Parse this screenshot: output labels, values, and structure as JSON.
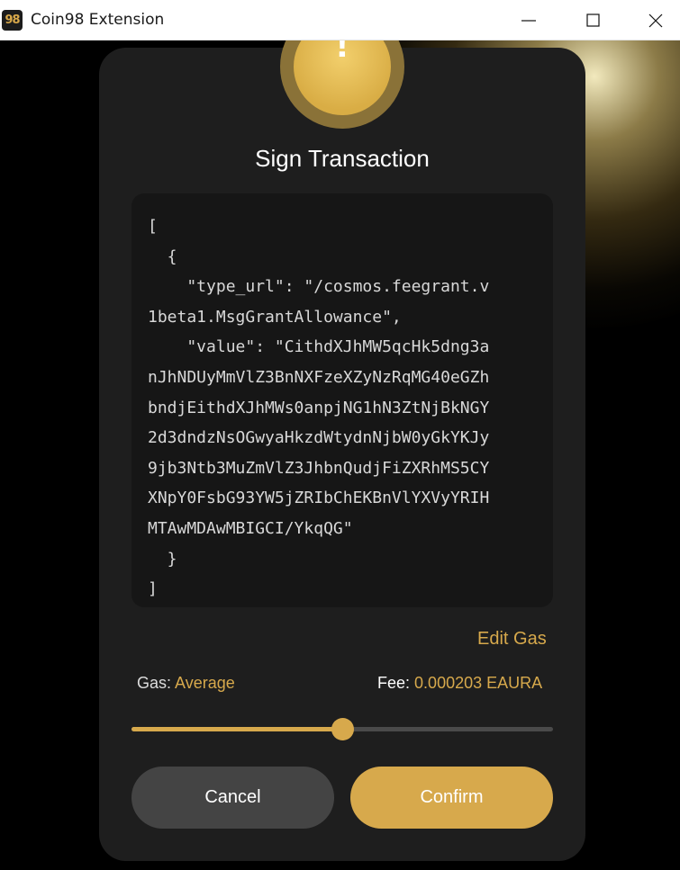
{
  "window": {
    "app_icon_text": "98",
    "title": "Coin98 Extension"
  },
  "dialog": {
    "alert_mark": "!",
    "title": "Sign Transaction",
    "payload": "[\n  {\n    \"type_url\": \"/cosmos.feegrant.v\n1beta1.MsgGrantAllowance\",\n    \"value\": \"CithdXJhMW5qcHk5dng3a\nnJhNDUyMmVlZ3BnNXFzeXZyNzRqMG40eGZh\nbndjEithdXJhMWs0anpjNG1hN3ZtNjBkNGY\n2d3dndzNsOGwyaHkzdWtydnNjbW0yGkYKJy\n9jb3Ntb3MuZmVlZ3JhbnQudjFiZXRhMS5CY\nXNpY0FsbG93YW5jZRIbChEKBnVlYXVyYRIH\nMTAwMDAwMBIGCI/YkqQG\"\n  }\n]",
    "edit_gas_label": "Edit Gas",
    "gas_label": "Gas:",
    "gas_value": "Average",
    "fee_label": "Fee:",
    "fee_value": "0.000203 EAURA",
    "gas_slider_level": 0.5,
    "cancel_label": "Cancel",
    "confirm_label": "Confirm"
  },
  "colors": {
    "accent": "#d7a94c",
    "panel": "#1e1e1e",
    "code_bg": "#161616",
    "cancel_bg": "#444444"
  }
}
